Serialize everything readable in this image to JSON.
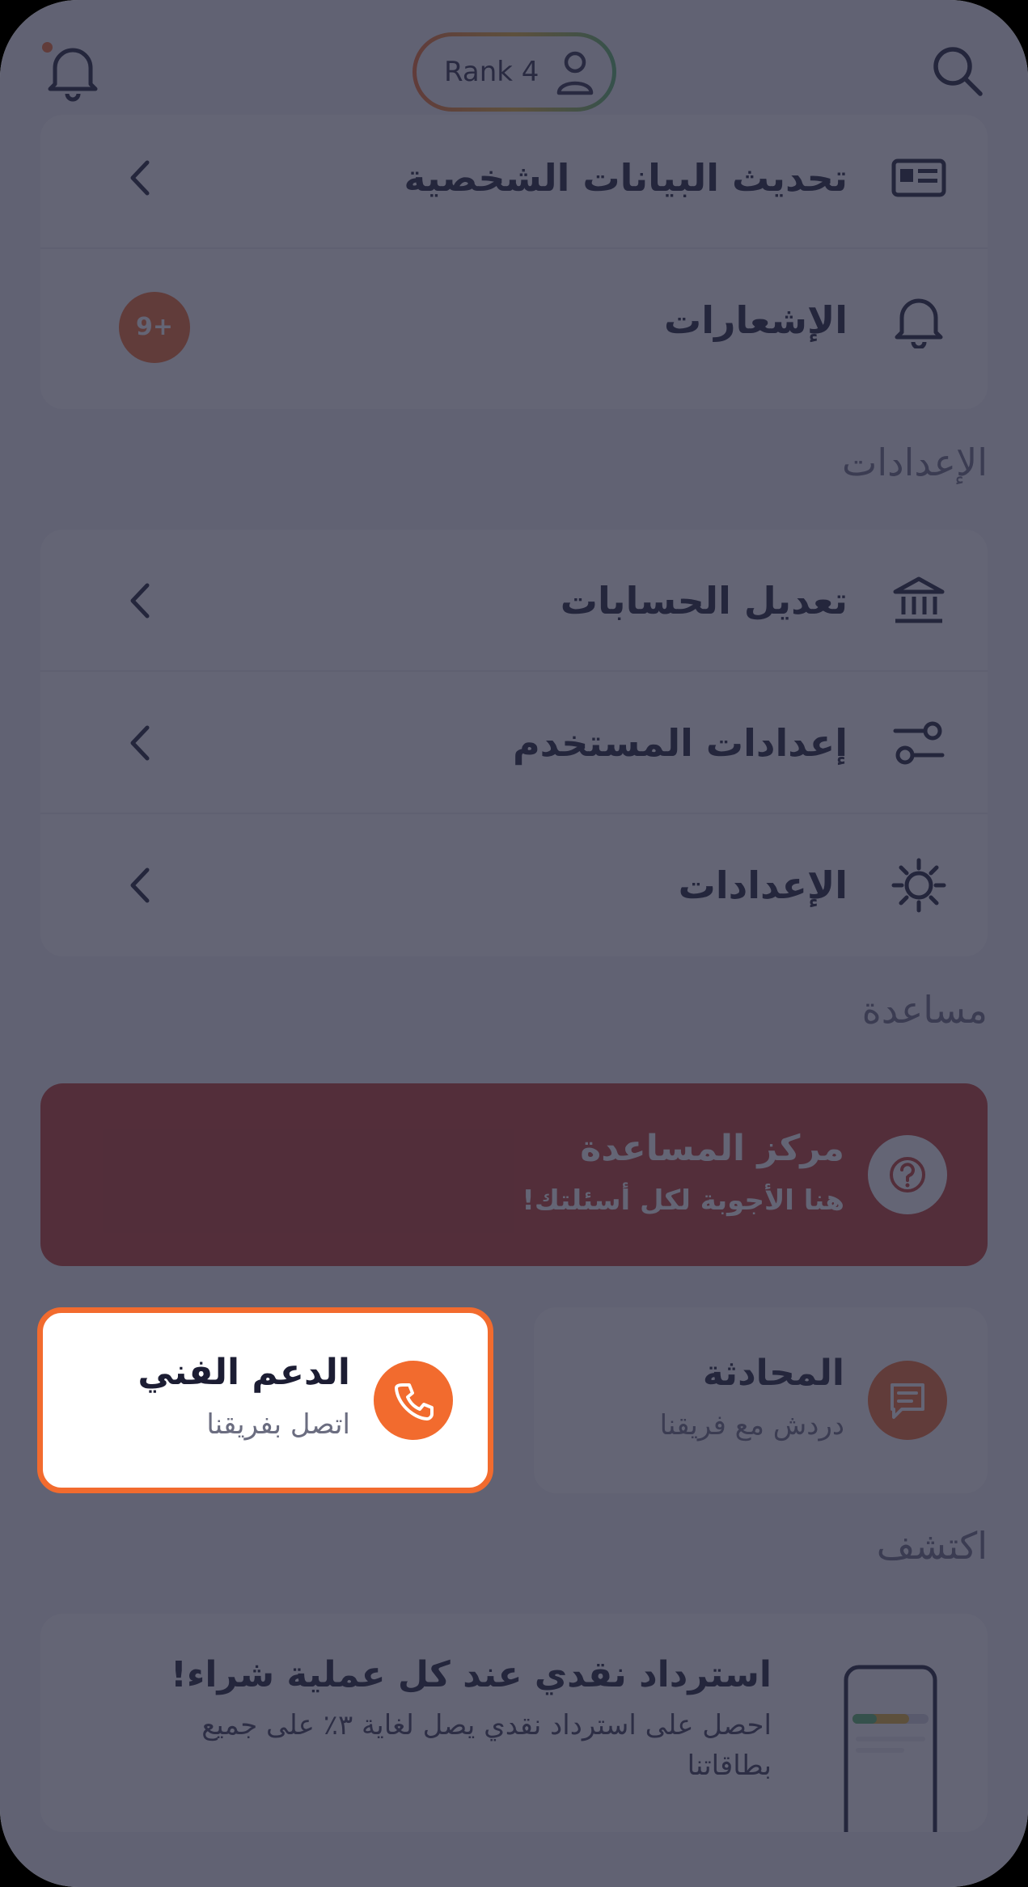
{
  "header": {
    "rank_label": "Rank 4",
    "notification_dot_color": "#f26b2e"
  },
  "profile_section": {
    "items": [
      {
        "label": "تحديث البيانات الشخصية",
        "icon": "id-card-icon"
      },
      {
        "label": "الإشعارات",
        "icon": "bell-icon",
        "badge": "9+"
      }
    ]
  },
  "settings_section": {
    "title": "الإعدادات",
    "items": [
      {
        "label": "تعديل الحسابات",
        "icon": "bank-icon"
      },
      {
        "label": "إعدادات المستخدم",
        "icon": "sliders-icon"
      },
      {
        "label": "الإعدادات",
        "icon": "gear-icon"
      }
    ]
  },
  "help_section": {
    "title": "مساعدة",
    "help_center": {
      "title": "مركز المساعدة",
      "subtitle": "هنا الأجوبة لكل أسئلتك!",
      "icon": "question-icon"
    },
    "chat": {
      "title": "المحادثة",
      "subtitle": "دردش مع فريقنا",
      "icon": "chat-icon"
    },
    "support": {
      "title": "الدعم الفني",
      "subtitle": "اتصل بفريقنا",
      "icon": "phone-icon"
    }
  },
  "discover_section": {
    "title": "اكتشف",
    "promo": {
      "title": "استرداد نقدي عند كل عملية شراء!",
      "body_line1": "احصل على استرداد نقدي يصل لغاية ٣٪ على جميع",
      "body_line2": "بطاقاتنا"
    }
  },
  "colors": {
    "accent": "#f26b2e",
    "help_center_bg": "#c0392b",
    "overlay": "rgba(40,42,64,0.72)"
  }
}
